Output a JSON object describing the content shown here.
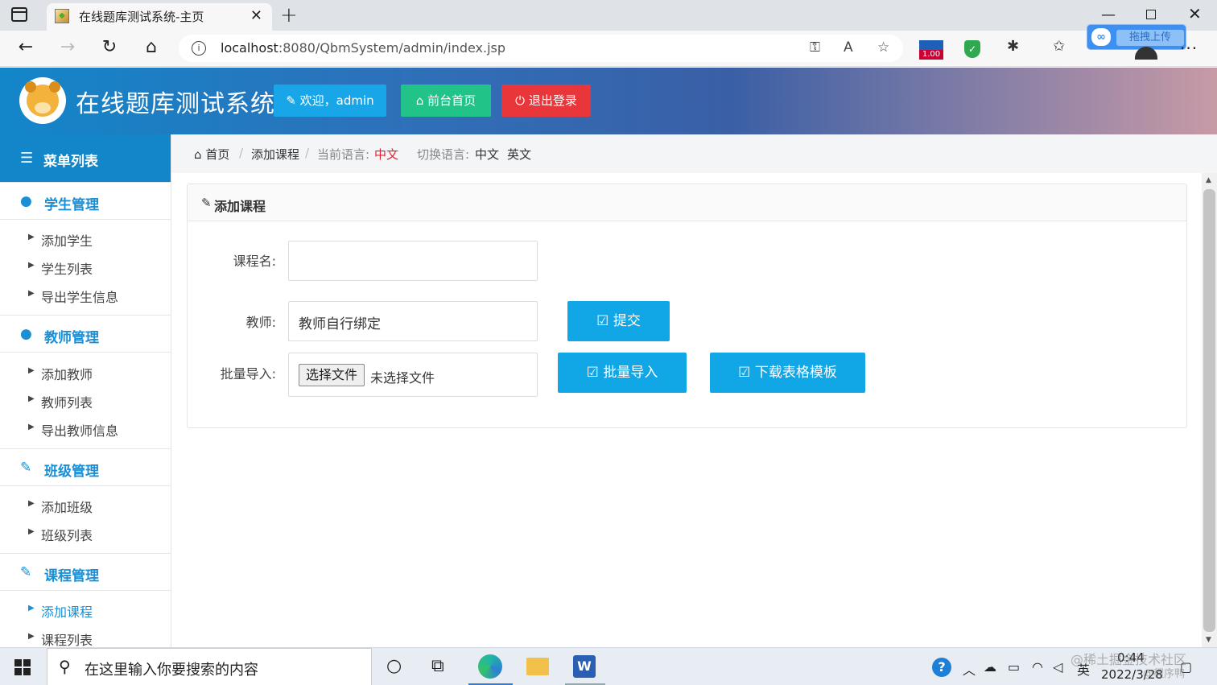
{
  "browser": {
    "tab_title": "在线题库测试系统-主页",
    "url_host": "localhost",
    "url_path": ":8080/QbmSystem/admin/index.jsp",
    "zoom_badge": "1.00",
    "upload_float_label": "拖拽上传"
  },
  "header": {
    "app_title": "在线题库测试系统",
    "welcome_btn": "欢迎，admin",
    "front_btn": "前台首页",
    "logout_btn": "退出登录"
  },
  "sidebar": {
    "menu_title": "菜单列表",
    "sections": [
      {
        "title": "学生管理",
        "icon": "user-icon",
        "items": [
          "添加学生",
          "学生列表",
          "导出学生信息"
        ]
      },
      {
        "title": "教师管理",
        "icon": "user-icon",
        "items": [
          "添加教师",
          "教师列表",
          "导出教师信息"
        ]
      },
      {
        "title": "班级管理",
        "icon": "edit-icon",
        "items": [
          "添加班级",
          "班级列表"
        ]
      },
      {
        "title": "课程管理",
        "icon": "edit-icon",
        "items": [
          "添加课程",
          "课程列表"
        ]
      }
    ],
    "active_item": "添加课程"
  },
  "breadcrumb": {
    "home": "首页",
    "current": "添加课程",
    "lang_label": "当前语言:",
    "lang_value": "中文",
    "switch_label": "切换语言:",
    "switch_zh": "中文",
    "switch_en": "英文"
  },
  "form": {
    "panel_title": "添加课程",
    "course_label": "课程名:",
    "course_value": "",
    "teacher_label": "教师:",
    "teacher_value": "教师自行绑定",
    "import_label": "批量导入:",
    "file_button": "选择文件",
    "file_status": "未选择文件",
    "submit_btn": "提交",
    "batch_btn": "批量导入",
    "template_btn": "下载表格模板"
  },
  "taskbar": {
    "search_placeholder": "在这里输入你要搜索的内容",
    "ime": "英",
    "time": "0:44",
    "date": "2022/3/28",
    "watermark_1": "@稀土掘金技术社区",
    "watermark_2": "@程序鸭"
  },
  "colors": {
    "primary": "#1386c9",
    "info_btn": "#11a6e6",
    "success_btn": "#22c389",
    "danger_btn": "#e8363a",
    "active_text": "#1a8fd6"
  }
}
